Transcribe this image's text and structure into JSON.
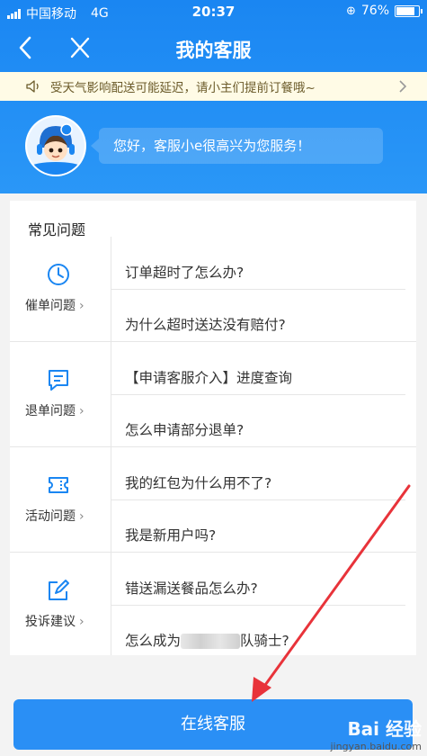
{
  "status_bar": {
    "carrier": "中国移动",
    "network": "4G",
    "time": "20:37",
    "battery": "76%",
    "battery_level": 0.76
  },
  "navbar": {
    "title": "我的客服"
  },
  "notice": {
    "text": "受天气影响配送可能延迟，请小主们提前订餐哦~"
  },
  "greeting": {
    "text": "您好，客服小e很高兴为您服务！"
  },
  "faq": {
    "title": "常见问题",
    "categories": [
      {
        "label": "催单问题",
        "icon": "clock-icon",
        "questions": [
          "订单超时了怎么办?",
          "为什么超时送达没有赔付?"
        ]
      },
      {
        "label": "退单问题",
        "icon": "message-icon",
        "questions": [
          "【申请客服介入】进度查询",
          "怎么申请部分退单?"
        ]
      },
      {
        "label": "活动问题",
        "icon": "ticket-icon",
        "questions": [
          "我的红包为什么用不了?",
          "我是新用户吗?"
        ]
      },
      {
        "label": "投诉建议",
        "icon": "edit-icon",
        "questions": [
          "错送漏送餐品怎么办?",
          "怎么成为",
          "队骑士?"
        ]
      }
    ]
  },
  "footer": {
    "button_label": "在线客服"
  },
  "watermark": {
    "main": "Bai 经验",
    "sub": "jingyan.baidu.com"
  },
  "colors": {
    "primary": "#1a86f2",
    "button": "#2a8ff5",
    "annotation_arrow": "#e8333a"
  }
}
